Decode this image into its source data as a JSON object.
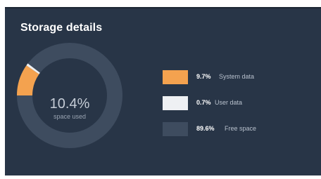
{
  "panel": {
    "title": "Storage details"
  },
  "donut": {
    "center_value": "10.4%",
    "center_label": "space used"
  },
  "legend": [
    {
      "percent": "9.7%",
      "label": "System data",
      "color": "#f4a24f",
      "value": 9.7
    },
    {
      "percent": "0.7%",
      "label": "User data",
      "color": "#eef0f3",
      "value": 0.7
    },
    {
      "percent": "89.6%",
      "label": "Free space",
      "color": "#3e4c5f",
      "value": 89.6
    }
  ]
}
